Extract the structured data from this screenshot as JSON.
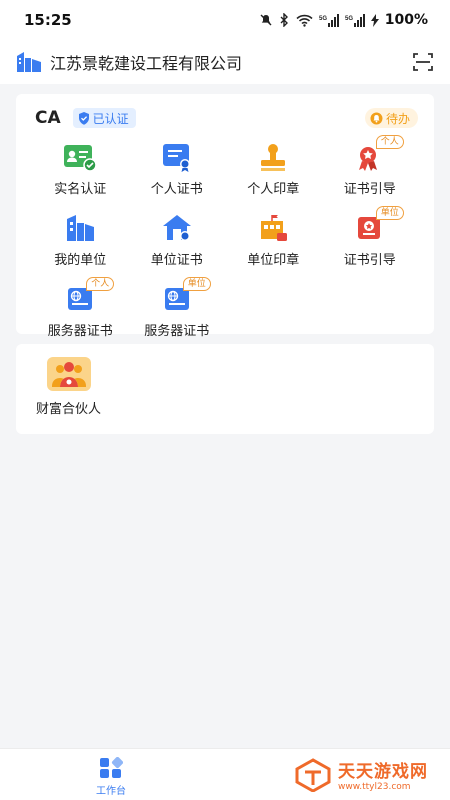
{
  "status_bar": {
    "time": "15:25",
    "battery": "100%",
    "icons": [
      "mute-icon",
      "bluetooth-icon",
      "wifi-icon",
      "signal-5g-icon",
      "signal-5g-icon",
      "battery-charging-icon"
    ]
  },
  "header": {
    "company_name": "江苏景乾建设工程有限公司",
    "scan_icon": "scan-icon"
  },
  "ca_section": {
    "title": "CA",
    "verified_label": "已认证",
    "todo_label": "待办",
    "items": [
      {
        "label": "实名认证",
        "icon": "real-name-auth-icon"
      },
      {
        "label": "个人证书",
        "icon": "personal-certificate-icon"
      },
      {
        "label": "个人印章",
        "icon": "personal-seal-icon"
      },
      {
        "label": "证书引导",
        "icon": "certificate-guide-icon",
        "tag": "个人"
      },
      {
        "label": "我的单位",
        "icon": "my-organization-icon"
      },
      {
        "label": "单位证书",
        "icon": "organization-certificate-icon"
      },
      {
        "label": "单位印章",
        "icon": "organization-seal-icon"
      },
      {
        "label": "证书引导",
        "icon": "certificate-guide-icon",
        "tag": "单位"
      },
      {
        "label": "服务器证书",
        "icon": "server-certificate-icon",
        "tag": "个人"
      },
      {
        "label": "服务器证书",
        "icon": "server-certificate-icon",
        "tag": "单位"
      }
    ]
  },
  "partner_section": {
    "label": "财富合伙人",
    "icon": "wealth-partner-icon"
  },
  "bottom_nav": {
    "tabs": [
      {
        "label": "工作台",
        "icon": "workbench-icon",
        "active": true
      }
    ]
  },
  "watermark": {
    "text": "天天游戏网",
    "url": "www.ttyl23.com"
  },
  "colors": {
    "primary": "#3a7cf0",
    "accent_orange": "#f2a01b",
    "success_green": "#3fb25a",
    "danger_red": "#e5483c",
    "background": "#f4f5f7"
  }
}
